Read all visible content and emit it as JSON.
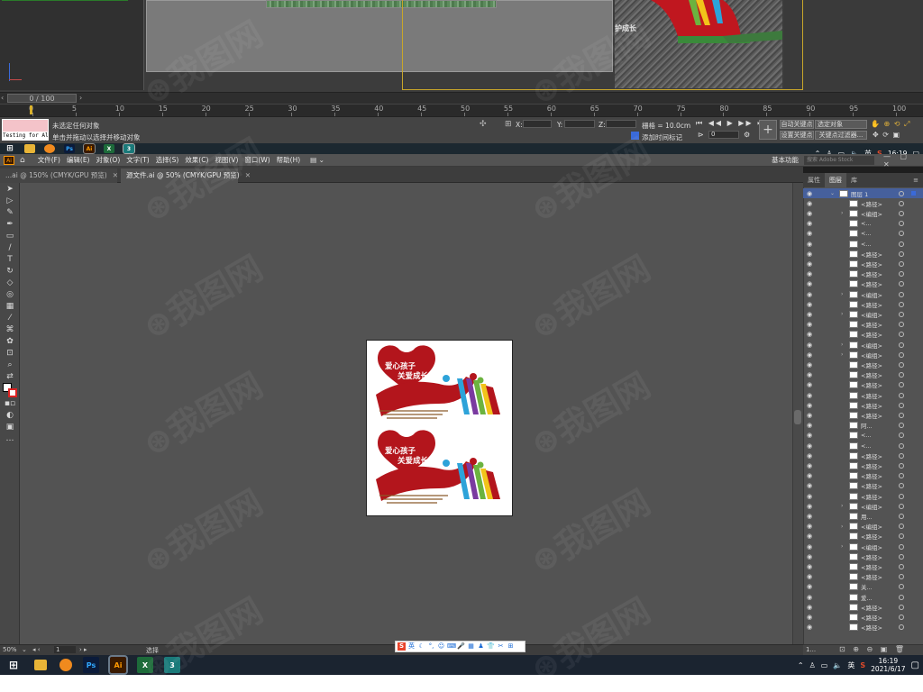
{
  "max": {
    "slider_label": "0 / 100",
    "ruler_ticks": [
      "0",
      "5",
      "10",
      "15",
      "20",
      "25",
      "30",
      "35",
      "40",
      "45",
      "50",
      "55",
      "60",
      "65",
      "70",
      "75",
      "80",
      "85",
      "90",
      "95",
      "100"
    ],
    "maxscript_text": "Testing for All",
    "status_line1": "未选定任何对象",
    "status_line2": "单击并拖动以选择并移动对象",
    "coord_x": "X:",
    "coord_y": "Y:",
    "coord_z": "Z:",
    "grid_label": "栅格 = 10.0cm",
    "add_time_tag": "添加时间标记",
    "auto_key": "自动关键点",
    "selected_obj": "选定对象",
    "set_key": "设置关键点",
    "key_filter": "关键点过滤器...",
    "frame_value": "0",
    "taskbar_time": "16:19",
    "taskbar_date": "2021/6/17",
    "taskbar_lang": "英",
    "tray_s": "S"
  },
  "ai": {
    "menus": [
      "文件(F)",
      "编辑(E)",
      "对象(O)",
      "文字(T)",
      "选择(S)",
      "效果(C)",
      "视图(V)",
      "窗口(W)",
      "帮助(H)"
    ],
    "workspace": "基本功能",
    "search_placeholder": "搜索 Adobe Stock",
    "tabs": [
      {
        "label": "...ai @ 150% (CMYK/GPU 预览)"
      },
      {
        "label": "源文件.ai @ 50% (CMYK/GPU 预览)"
      }
    ],
    "panel_tabs": [
      "属性",
      "图层",
      "库"
    ],
    "layer_top": "图层 1",
    "layers": [
      "<路径>",
      "<编组>",
      "<...",
      "<...",
      "<...",
      "<路径>",
      "<路径>",
      "<路径>",
      "<路径>",
      "<编组>",
      "<路径>",
      "<编组>",
      "<路径>",
      "<路径>",
      "<编组>",
      "<编组>",
      "<路径>",
      "<路径>",
      "<路径>",
      "<路径>",
      "<路径>",
      "<路径>",
      "阿...",
      "<...",
      "<...",
      "<路径>",
      "<路径>",
      "<路径>",
      "<路径>",
      "<路径>",
      "<编组>",
      "用...",
      "<编组>",
      "<路径>",
      "<编组>",
      "<路径>",
      "<路径>",
      "<路径>",
      "关...",
      "爱...",
      "<路径>",
      "<路径>",
      "<路径>"
    ],
    "zoom": "50%",
    "artboard_num": "1",
    "status_tool": "选择",
    "panel_footer": "1..."
  },
  "artwork": {
    "line1": "爱心孩子",
    "line2": "关爱成长",
    "heart_color": "#b3151c",
    "blue": "#2da3d9",
    "green": "#6cb33f",
    "yellow": "#f2c41a",
    "purple": "#7a3aa0"
  },
  "taskbar": {
    "time": "16:19",
    "date": "2021/6/17",
    "lang": "英"
  }
}
